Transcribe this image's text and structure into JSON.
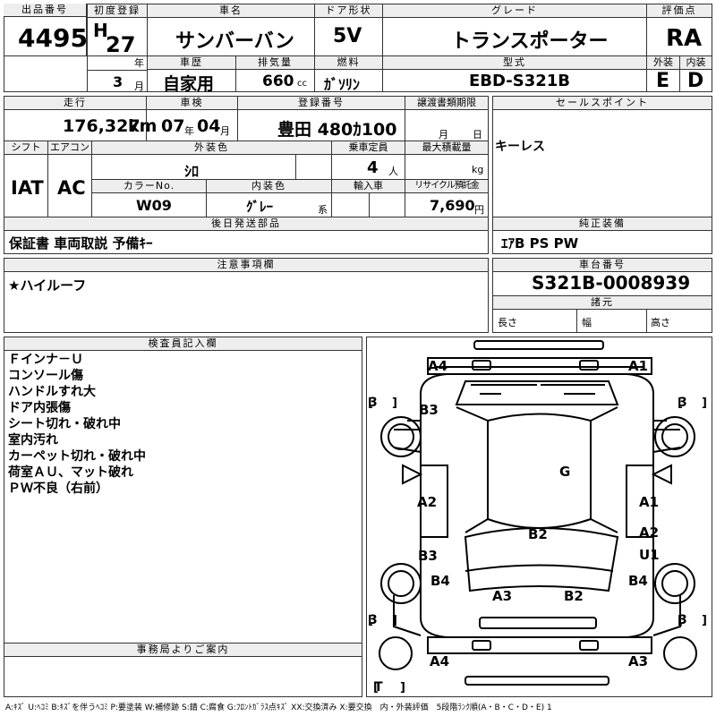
{
  "header": {
    "lot_label": "出品番号",
    "lot_no": "4495",
    "first_reg_label": "初度登録",
    "era": "H",
    "year": "27",
    "year_unit": "年",
    "month": "3",
    "month_unit": "月",
    "car_name_label": "車名",
    "car_name": "サンバーバン",
    "door_label": "ドア形状",
    "door": "5V",
    "grade_label": "グレード",
    "grade": "トランスポーター",
    "score_label": "評価点",
    "score": "RA",
    "history_label": "車歴",
    "history": "自家用",
    "displacement_label": "排気量",
    "displacement": "660",
    "displacement_unit": "cc",
    "fuel_label": "燃料",
    "fuel": "ｶﾞｿﾘﾝ",
    "model_label": "型式",
    "model": "EBD-S321B",
    "ext_label": "外装",
    "ext_grade": "E",
    "int_label": "内装",
    "int_grade": "D"
  },
  "row2": {
    "mileage_label": "走行",
    "mileage": "176,327",
    "mileage_unit": "km",
    "inspection_label": "車検",
    "insp_year": "07",
    "insp_year_unit": "年",
    "insp_month": "04",
    "insp_month_unit": "月",
    "plate_label": "登録番号",
    "plate": "豊田 480ｶ100",
    "transfer_label": "譲渡書類期限",
    "transfer_month": "月",
    "transfer_day": "日",
    "selling_label": "セールスポイント",
    "selling": "キーレス",
    "shift_label": "シフト",
    "shift": "IAT",
    "ac_label": "エアコン",
    "ac": "AC",
    "color_label": "外装色",
    "color": "ｼﾛ",
    "capacity_label": "乗車定員",
    "capacity": "4",
    "capacity_unit": "人",
    "load_label": "最大積載量",
    "load_unit": "kg",
    "colorno_label": "カラーNo.",
    "colorno": "W09",
    "interior_label": "内装色",
    "interior": "ｸﾞﾚｰ",
    "interior_unit": "系",
    "import_label": "輸入車",
    "recycle_label": "リサイクル預託金",
    "recycle": "7,690",
    "recycle_unit": "円"
  },
  "parts": {
    "later_label": "後日発送部品",
    "later": "保証書 車両取説 予備ｷｰ",
    "genuine_label": "純正装備",
    "genuine": "ｴｱB PS PW"
  },
  "notes": {
    "label": "注意事項欄",
    "text": "★ハイルーフ"
  },
  "chassis": {
    "label": "車台番号",
    "number": "S321B-0008939",
    "spec_label": "諸元",
    "length": "長さ",
    "width": "幅",
    "height": "高さ"
  },
  "inspector": {
    "label": "検査員記入欄",
    "lines": [
      "Ｆインナ－Ｕ",
      "コンソール傷",
      "ハンドルすれ大",
      "ドア内張傷",
      "シート切れ・破れ中",
      "室内汚れ",
      "カーペット切れ・破れ中",
      "荷室ＡＵ、マット破れ",
      "ＰＷ不良（右前）"
    ]
  },
  "office": {
    "label": "事務局よりご案内"
  },
  "diagram": {
    "marks": {
      "a4_top": "A4",
      "a1_top": "A1",
      "b3_upper": "B3",
      "g": "G",
      "a2_left": "A2",
      "a1_right": "A1",
      "a2_right": "A2",
      "u1": "U1",
      "b2_center": "B2",
      "b3_lower": "B3",
      "b4_left": "B4",
      "b4_right": "B4",
      "a3_center": "A3",
      "b2_lower": "B2",
      "a4_bottom": "A4",
      "a3_bottom": "A3"
    },
    "tires": {
      "fl": "3",
      "fr": "3",
      "rl": "3",
      "rr": "3",
      "spare": "T"
    }
  },
  "legend": "A:ｷｽﾞ U:ﾍｺﾐ B:ｷｽﾞを伴うﾍｺﾐ P:要塗装 W:補修跡 S:錆 C:腐食 G:ﾌﾛﾝﾄｶﾞﾗｽ点ｷｽﾞ XX:交換済み X:要交換　内・外装評価　5段階ﾗﾝｸ順(A・B・C・D・E) 1"
}
